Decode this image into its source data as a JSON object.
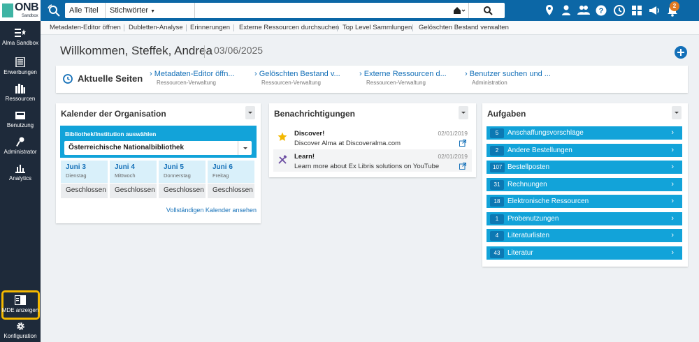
{
  "colors": {
    "sidebar": "#1e2a3a",
    "topbar": "#0c67a6",
    "accent": "#12a3d9",
    "highlight": "#f3b800",
    "badge": "#e07a22"
  },
  "logo": {
    "name": "ONB",
    "tagline": "Sandbox"
  },
  "sidebar": {
    "items": [
      {
        "label": "Alma Sandbox",
        "icon": "star-menu-icon"
      },
      {
        "label": "Erwerbungen",
        "icon": "acquisitions-icon"
      },
      {
        "label": "Ressourcen",
        "icon": "books-icon"
      },
      {
        "label": "Benutzung",
        "icon": "inbox-icon"
      },
      {
        "label": "Administrator",
        "icon": "key-icon"
      },
      {
        "label": "Analytics",
        "icon": "bar-chart-icon"
      }
    ],
    "bottom_items": [
      {
        "label": "MDE anzeigen",
        "icon": "mde-icon"
      },
      {
        "label": "Konfiguration",
        "icon": "gear-icon"
      }
    ]
  },
  "search": {
    "scope": "Alle Titel",
    "field": "Stichwörter",
    "value": "",
    "placeholder": ""
  },
  "top_icons": [
    "location-icon",
    "user-icon",
    "users-icon",
    "help-icon",
    "history-icon",
    "grid-icon",
    "announcement-icon",
    "notifications-icon"
  ],
  "notifications_count": "2",
  "subnav": [
    "Metadaten-Editor öffnen",
    "Dubletten-Analyse",
    "Erinnerungen",
    "Externe Ressourcen durchsuchen",
    "Top Level Sammlungen",
    "Gelöschten Bestand verwalten"
  ],
  "welcome": {
    "text": "Willkommen, Steffek, Andrea",
    "date": "03/06/2025"
  },
  "recent": {
    "title": "Aktuelle Seiten",
    "links": [
      {
        "label": "Metadaten-Editor öffn...",
        "sub": "Ressourcen-Verwaltung"
      },
      {
        "label": "Gelöschten Bestand v...",
        "sub": "Ressourcen-Verwaltung"
      },
      {
        "label": "Externe Ressourcen d...",
        "sub": "Ressourcen-Verwaltung"
      },
      {
        "label": "Benutzer suchen und ...",
        "sub": "Administration"
      }
    ]
  },
  "calendar": {
    "title": "Kalender der Organisation",
    "select_label": "Bibliothek/Institution auswählen",
    "selected": "Österreichische Nationalbibliothek",
    "days": [
      {
        "date": "Juni 3",
        "weekday": "Dienstag",
        "status": "Geschlossen"
      },
      {
        "date": "Juni 4",
        "weekday": "Mittwoch",
        "status": "Geschlossen"
      },
      {
        "date": "Juni 5",
        "weekday": "Donnerstag",
        "status": "Geschlossen"
      },
      {
        "date": "Juni 6",
        "weekday": "Freitag",
        "status": "Geschlossen"
      }
    ],
    "full_link": "Vollständigen Kalender ansehen"
  },
  "notifications": {
    "title": "Benachrichtigungen",
    "items": [
      {
        "title": "Discover!",
        "text": "Discover Alma at Discoveralma.com",
        "date": "02/01/2019",
        "icon": "star-icon"
      },
      {
        "title": "Learn!",
        "text": "Learn more about Ex Libris solutions on YouTube",
        "date": "02/01/2019",
        "icon": "tools-icon"
      }
    ]
  },
  "tasks": {
    "title": "Aufgaben",
    "items": [
      {
        "count": "5",
        "label": "Anschaffungsvorschläge"
      },
      {
        "count": "2",
        "label": "Andere Bestellungen"
      },
      {
        "count": "107",
        "label": "Bestellposten"
      },
      {
        "count": "31",
        "label": "Rechnungen"
      },
      {
        "count": "18",
        "label": "Elektronische Ressourcen"
      },
      {
        "count": "1",
        "label": "Probenutzungen"
      },
      {
        "count": "4",
        "label": "Literaturlisten"
      },
      {
        "count": "43",
        "label": "Literatur"
      }
    ]
  }
}
